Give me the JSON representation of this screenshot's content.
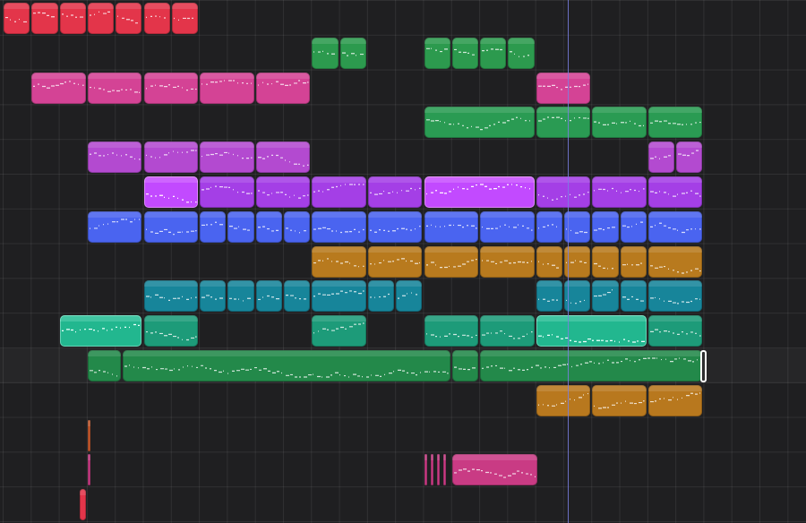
{
  "colors": {
    "background": "#1f1f21",
    "playhead": "#7a7fe0"
  },
  "playhead_time": 20.0,
  "tracks": [
    {
      "color": "#e3354a",
      "regions": [
        [
          0,
          1
        ],
        [
          1,
          1
        ],
        [
          2,
          1
        ],
        [
          3,
          1
        ],
        [
          4,
          1
        ],
        [
          5,
          1
        ],
        [
          6,
          1
        ]
      ]
    },
    {
      "color": "#2c9a4e",
      "regions": [
        [
          11,
          1
        ],
        [
          12,
          1
        ],
        [
          15,
          1
        ],
        [
          16,
          1
        ],
        [
          17,
          1
        ],
        [
          18,
          1
        ]
      ]
    },
    {
      "color": "#d44395",
      "regions": [
        [
          1,
          2
        ],
        [
          3,
          2
        ],
        [
          5,
          2
        ],
        [
          7,
          2
        ],
        [
          9,
          2
        ],
        [
          19,
          2
        ]
      ]
    },
    {
      "color": "#2a9b53",
      "regions": [
        [
          15,
          4
        ],
        [
          19,
          2
        ],
        [
          21,
          2
        ],
        [
          23,
          2
        ]
      ]
    },
    {
      "color": "#b34ad0",
      "regions": [
        [
          3,
          2
        ],
        [
          5,
          2
        ],
        [
          7,
          2
        ],
        [
          9,
          2
        ],
        [
          23,
          1
        ],
        [
          24,
          1
        ]
      ]
    },
    {
      "color": "#a43fe6",
      "regions": [
        [
          5,
          2,
          "sel"
        ],
        [
          7,
          2
        ],
        [
          9,
          2
        ],
        [
          11,
          2
        ],
        [
          13,
          2
        ],
        [
          15,
          4,
          "sel"
        ],
        [
          19,
          2
        ],
        [
          21,
          2
        ],
        [
          23,
          2
        ]
      ]
    },
    {
      "color": "#4a64f0",
      "regions": [
        [
          3,
          2
        ],
        [
          5,
          2
        ],
        [
          7,
          1
        ],
        [
          8,
          1
        ],
        [
          9,
          1
        ],
        [
          10,
          1
        ],
        [
          11,
          2
        ],
        [
          13,
          2
        ],
        [
          15,
          2
        ],
        [
          17,
          2
        ],
        [
          19,
          1
        ],
        [
          20,
          1
        ],
        [
          21,
          1
        ],
        [
          22,
          1
        ],
        [
          23,
          2
        ]
      ]
    },
    {
      "color": "#b87a1e",
      "regions": [
        [
          11,
          2
        ],
        [
          13,
          2
        ],
        [
          15,
          2
        ],
        [
          17,
          2
        ],
        [
          19,
          1
        ],
        [
          20,
          1
        ],
        [
          21,
          1
        ],
        [
          22,
          1
        ],
        [
          23,
          2
        ]
      ]
    },
    {
      "color": "#17859a",
      "regions": [
        [
          5,
          2
        ],
        [
          7,
          1
        ],
        [
          8,
          1
        ],
        [
          9,
          1
        ],
        [
          10,
          1
        ],
        [
          11,
          2
        ],
        [
          13,
          1
        ],
        [
          14,
          1
        ],
        [
          19,
          1
        ],
        [
          20,
          1
        ],
        [
          21,
          1
        ],
        [
          22,
          1
        ],
        [
          23,
          2
        ]
      ]
    },
    {
      "color": "#1d9b79",
      "regions": [
        [
          2,
          3,
          "sel"
        ],
        [
          5,
          2
        ],
        [
          11,
          2
        ],
        [
          15,
          2
        ],
        [
          17,
          2
        ],
        [
          19,
          4,
          "sel"
        ],
        [
          23,
          2
        ]
      ]
    },
    {
      "color": "#23894a",
      "regions": [
        [
          3,
          1.25
        ],
        [
          4.25,
          11.75
        ],
        [
          16,
          1
        ],
        [
          17,
          8
        ]
      ]
    },
    {
      "color": "#b8781e",
      "regions": [
        [
          19,
          2
        ],
        [
          21,
          2
        ],
        [
          23,
          2
        ]
      ]
    },
    {
      "color": "#c95a2e",
      "regions": [
        [
          3,
          0.15
        ]
      ]
    },
    {
      "color": "#c93b84",
      "regions": [
        [
          3,
          0.17
        ],
        [
          15,
          0.17
        ],
        [
          15.23,
          0.17
        ],
        [
          15.46,
          0.17
        ],
        [
          15.69,
          0.17
        ],
        [
          16,
          3.1
        ]
      ]
    },
    {
      "color": "#e3354a",
      "regions": [
        [
          2.7,
          0.3
        ]
      ]
    }
  ]
}
